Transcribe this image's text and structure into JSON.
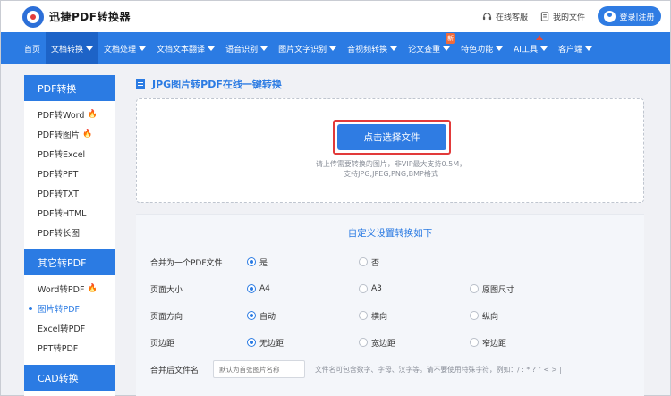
{
  "header": {
    "logo_text": "迅捷PDF转换器",
    "service_label": "在线客服",
    "files_label": "我的文件",
    "login_label": "登录|注册"
  },
  "nav": {
    "items": [
      {
        "label": "首页"
      },
      {
        "label": "文档转换"
      },
      {
        "label": "文档处理"
      },
      {
        "label": "文档文本翻译"
      },
      {
        "label": "语音识别"
      },
      {
        "label": "图片文字识别"
      },
      {
        "label": "音视频转换"
      },
      {
        "label": "论文查重"
      },
      {
        "label": "特色功能"
      },
      {
        "label": "AI工具"
      },
      {
        "label": "客户端"
      }
    ],
    "new_badge": "新"
  },
  "sidebar": {
    "sections": [
      {
        "title": "PDF转换",
        "items": [
          "PDF转Word",
          "PDF转图片",
          "PDF转Excel",
          "PDF转PPT",
          "PDF转TXT",
          "PDF转HTML",
          "PDF转长图"
        ]
      },
      {
        "title": "其它转PDF",
        "items": [
          "Word转PDF",
          "图片转PDF",
          "Excel转PDF",
          "PPT转PDF"
        ]
      },
      {
        "title": "CAD转换",
        "items": []
      }
    ]
  },
  "main": {
    "title": "JPG图片转PDF在线一键转换",
    "upload_button": "点击选择文件",
    "hint_line1": "请上传需要转换的图片，非VIP最大支持0.5M，",
    "hint_line2": "支持JPG,JPEG,PNG,BMP格式"
  },
  "settings": {
    "title": "自定义设置转换如下",
    "merge": {
      "label": "合并为一个PDF文件",
      "options": [
        "是",
        "否"
      ],
      "selected": "是"
    },
    "page_size": {
      "label": "页面大小",
      "options": [
        "A4",
        "A3",
        "原图尺寸"
      ],
      "selected": "A4"
    },
    "orientation": {
      "label": "页面方向",
      "options": [
        "自动",
        "横向",
        "纵向"
      ],
      "selected": "自动"
    },
    "margin": {
      "label": "页边距",
      "options": [
        "无边距",
        "宽边距",
        "窄边距"
      ],
      "selected": "无边距"
    },
    "filename": {
      "label": "合并后文件名",
      "placeholder": "默认为首张图片名称",
      "note": "文件名可包含数字、字母、汉字等。请不要使用特殊字符，例如：/ : * ? \" < > |"
    }
  },
  "colors": {
    "accent": "#2b7be3",
    "highlight": "#e23a3a",
    "flame": "#f26b2c"
  }
}
